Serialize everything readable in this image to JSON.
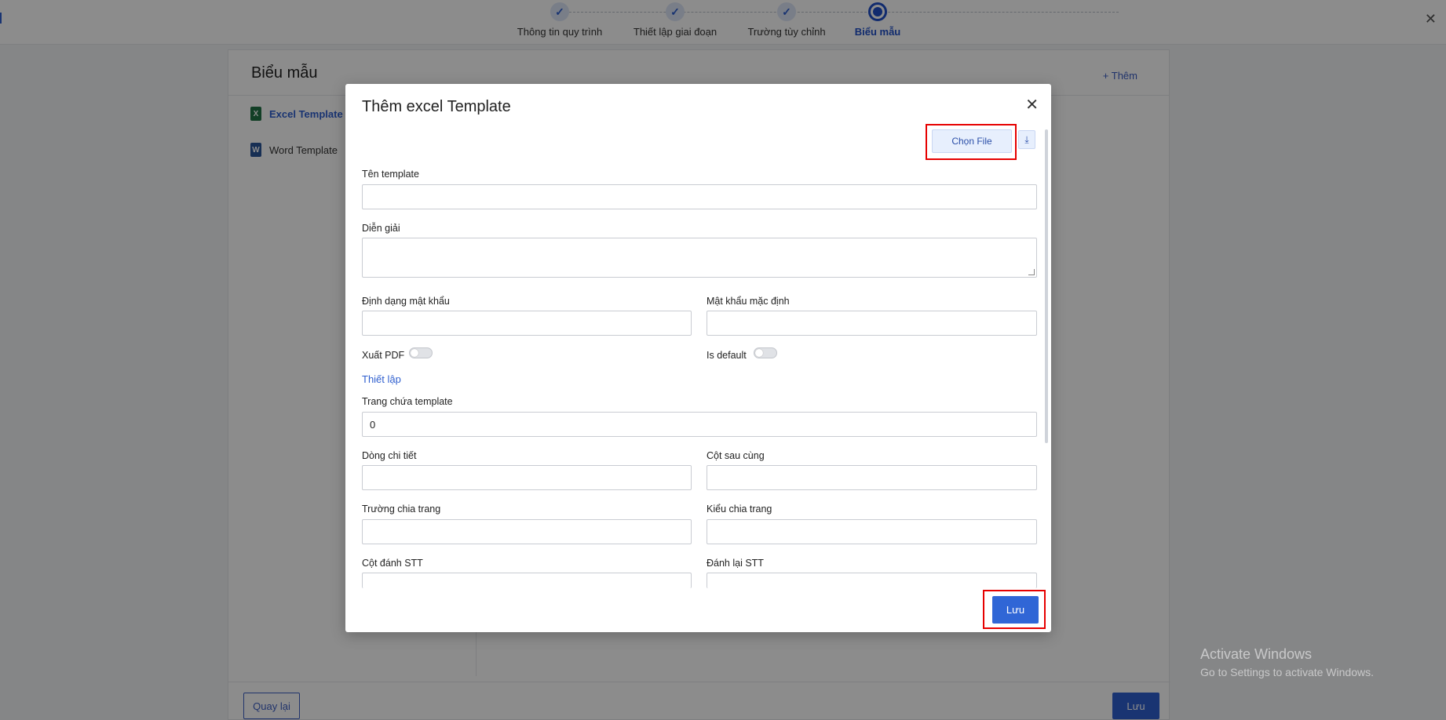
{
  "stepper": {
    "steps": [
      {
        "label": "Thông tin quy trình",
        "state": "done"
      },
      {
        "label": "Thiết lập giai đoạn",
        "state": "done"
      },
      {
        "label": "Trường tùy chỉnh",
        "state": "done"
      },
      {
        "label": "Biểu mẫu",
        "state": "active"
      }
    ],
    "check": "✓"
  },
  "page": {
    "close": "✕",
    "title": "Biểu mẫu",
    "add_label": "+ Thêm",
    "sidebar": [
      {
        "label": "Excel Template",
        "icon": "X"
      },
      {
        "label": "Word Template",
        "icon": "W"
      }
    ],
    "back_label": "Quay lại",
    "save_label": "Lưu"
  },
  "modal": {
    "title": "Thêm excel Template",
    "close": "✕",
    "choose_file_label": "Chọn File",
    "download_glyph": "⤓",
    "fields": {
      "template_name": {
        "label": "Tên template",
        "value": ""
      },
      "description": {
        "label": "Diễn giải",
        "value": ""
      },
      "password_format": {
        "label": "Định dạng mật khẩu",
        "value": ""
      },
      "default_password": {
        "label": "Mật khẩu mặc định",
        "value": ""
      },
      "export_pdf": {
        "label": "Xuất PDF",
        "on": false
      },
      "is_default": {
        "label": "Is default",
        "on": false
      },
      "setup_link": "Thiết lập",
      "template_sheet": {
        "label": "Trang chứa template",
        "value": "0"
      },
      "detail_row": {
        "label": "Dòng chi tiết",
        "value": ""
      },
      "last_column": {
        "label": "Cột sau cùng",
        "value": ""
      },
      "page_break_field": {
        "label": "Trường chia trang",
        "value": ""
      },
      "page_break_type": {
        "label": "Kiểu chia trang",
        "value": ""
      },
      "stt_column": {
        "label": "Cột đánh STT",
        "value": ""
      },
      "renumber_stt": {
        "label": "Đánh lại STT",
        "value": ""
      }
    },
    "save_label": "Lưu"
  },
  "watermark": {
    "line1": "Activate Windows",
    "line2": "Go to Settings to activate Windows."
  },
  "colors": {
    "primary": "#3066d6",
    "highlight": "#e60000"
  }
}
